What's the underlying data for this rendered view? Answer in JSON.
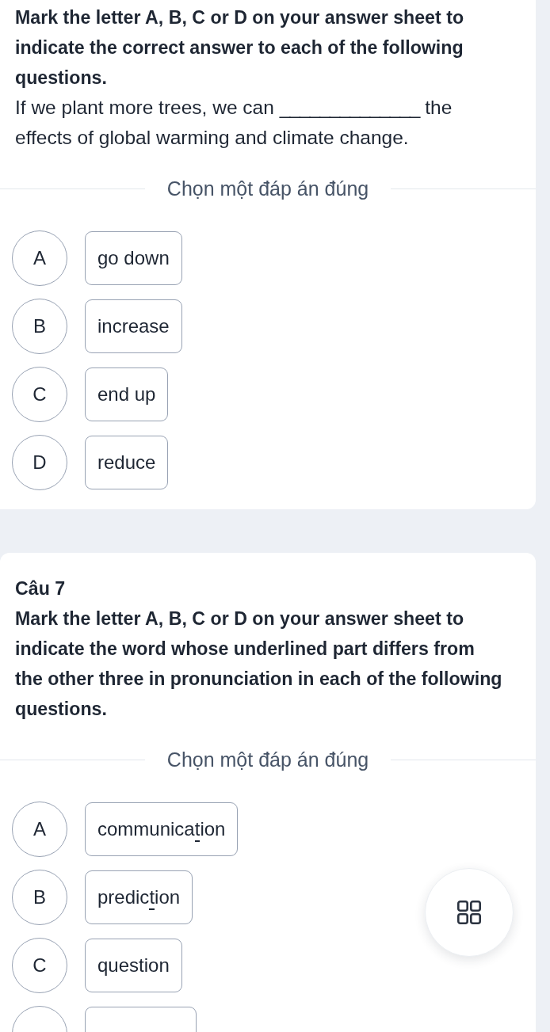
{
  "cards": [
    {
      "instruction": "Mark the letter A, B, C or D on your answer sheet to indicate the correct answer to each of the following questions.",
      "question": {
        "before": "If we plant more trees, we can",
        "blank": "______________",
        "after": "the effects of global warming and climate change."
      },
      "prompt": "Chọn một đáp án đúng",
      "options": [
        {
          "letter": "A",
          "parts": [
            {
              "text": "go down",
              "underlined": false
            }
          ],
          "selected": false
        },
        {
          "letter": "B",
          "parts": [
            {
              "text": "increase",
              "underlined": false
            }
          ],
          "selected": false
        },
        {
          "letter": "C",
          "parts": [
            {
              "text": "end up",
              "underlined": false
            }
          ],
          "selected": false
        },
        {
          "letter": "D",
          "parts": [
            {
              "text": "reduce",
              "underlined": false
            }
          ],
          "selected": false
        }
      ]
    },
    {
      "title": "Câu 7",
      "instruction": "Mark the letter A, B, C or D on your answer sheet to indicate the word whose underlined part differs from the other three in pronunciation in each of the following questions.",
      "prompt": "Chọn một đáp án đúng",
      "options": [
        {
          "letter": "A",
          "parts": [
            {
              "text": "communica",
              "underlined": false
            },
            {
              "text": "t",
              "underlined": true
            },
            {
              "text": "ion",
              "underlined": false
            }
          ],
          "selected": false
        },
        {
          "letter": "B",
          "parts": [
            {
              "text": "predic",
              "underlined": false
            },
            {
              "text": "t",
              "underlined": true
            },
            {
              "text": "ion",
              "underlined": false
            }
          ],
          "selected": false
        },
        {
          "letter": "C",
          "parts": [
            {
              "text": "question",
              "underlined": false
            }
          ],
          "selected": false
        },
        {
          "selected": false
        }
      ]
    }
  ],
  "fab": {
    "kind": "grid"
  }
}
